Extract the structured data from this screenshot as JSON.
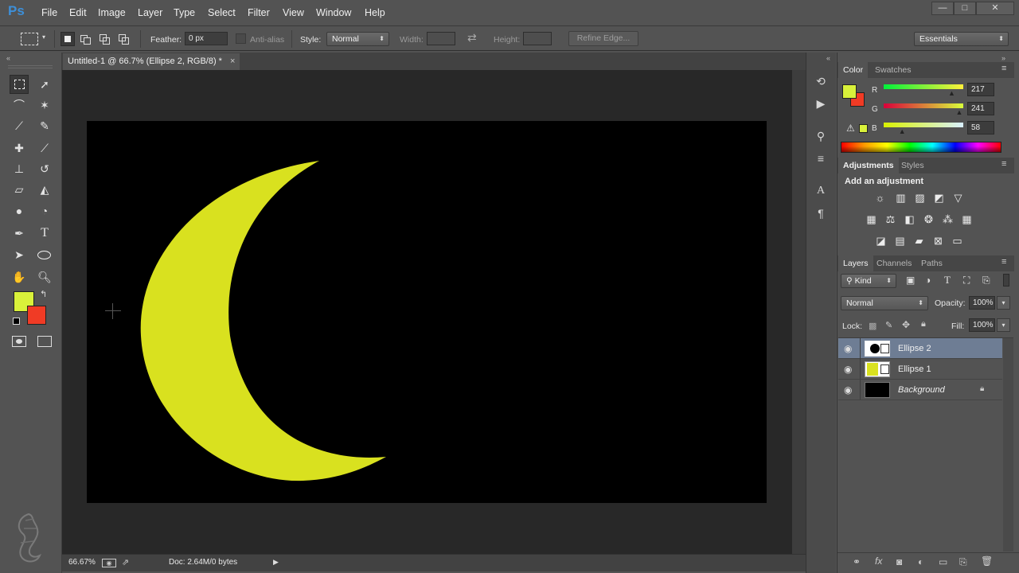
{
  "app": {
    "logo": "Ps"
  },
  "menu": [
    "File",
    "Edit",
    "Image",
    "Layer",
    "Type",
    "Select",
    "Filter",
    "View",
    "Window",
    "Help"
  ],
  "window_controls": {
    "minimize": "—",
    "maximize": "□",
    "close": "✕"
  },
  "options_bar": {
    "feather_label": "Feather:",
    "feather_value": "0 px",
    "antialias_label": "Anti-alias",
    "style_label": "Style:",
    "style_value": "Normal",
    "width_label": "Width:",
    "height_label": "Height:",
    "refine_edge": "Refine Edge...",
    "workspace": "Essentials"
  },
  "document": {
    "tab_title": "Untitled-1 @ 66.7% (Ellipse 2, RGB/8) *",
    "close": "×"
  },
  "status_bar": {
    "zoom": "66.67%",
    "doc_info": "Doc: 2.64M/0 bytes"
  },
  "colors": {
    "foreground": "#d9f13a",
    "background": "#f03b25",
    "moon": "#d9e11f",
    "canvas": "#000000"
  },
  "color_panel": {
    "tabs": [
      "Color",
      "Swatches"
    ],
    "channels": [
      {
        "label": "R",
        "value": "217"
      },
      {
        "label": "G",
        "value": "241"
      },
      {
        "label": "B",
        "value": "58"
      }
    ],
    "slider_levels": {
      "R": 0.85,
      "G": 0.945,
      "B": 0.227
    }
  },
  "adjustments_panel": {
    "tabs": [
      "Adjustments",
      "Styles"
    ],
    "heading": "Add an adjustment"
  },
  "layers_panel": {
    "tabs": [
      "Layers",
      "Channels",
      "Paths"
    ],
    "filter_label": "Kind",
    "blend_mode": "Normal",
    "opacity_label": "Opacity:",
    "opacity_value": "100%",
    "lock_label": "Lock:",
    "fill_label": "Fill:",
    "fill_value": "100%",
    "layers": [
      {
        "name": "Ellipse 2",
        "active": true
      },
      {
        "name": "Ellipse 1",
        "active": false
      },
      {
        "name": "Background",
        "active": false
      }
    ]
  },
  "icons": [
    "marquee-icon",
    "move-icon",
    "lasso-icon",
    "magic-wand-icon",
    "crop-icon",
    "eyedropper-icon",
    "healing-icon",
    "brush-icon",
    "stamp-icon",
    "history-brush-icon",
    "eraser-icon",
    "paint-bucket-icon",
    "blur-icon",
    "dodge-icon",
    "pen-icon",
    "type-icon",
    "path-select-icon",
    "ellipse-icon",
    "hand-icon",
    "zoom-icon"
  ]
}
